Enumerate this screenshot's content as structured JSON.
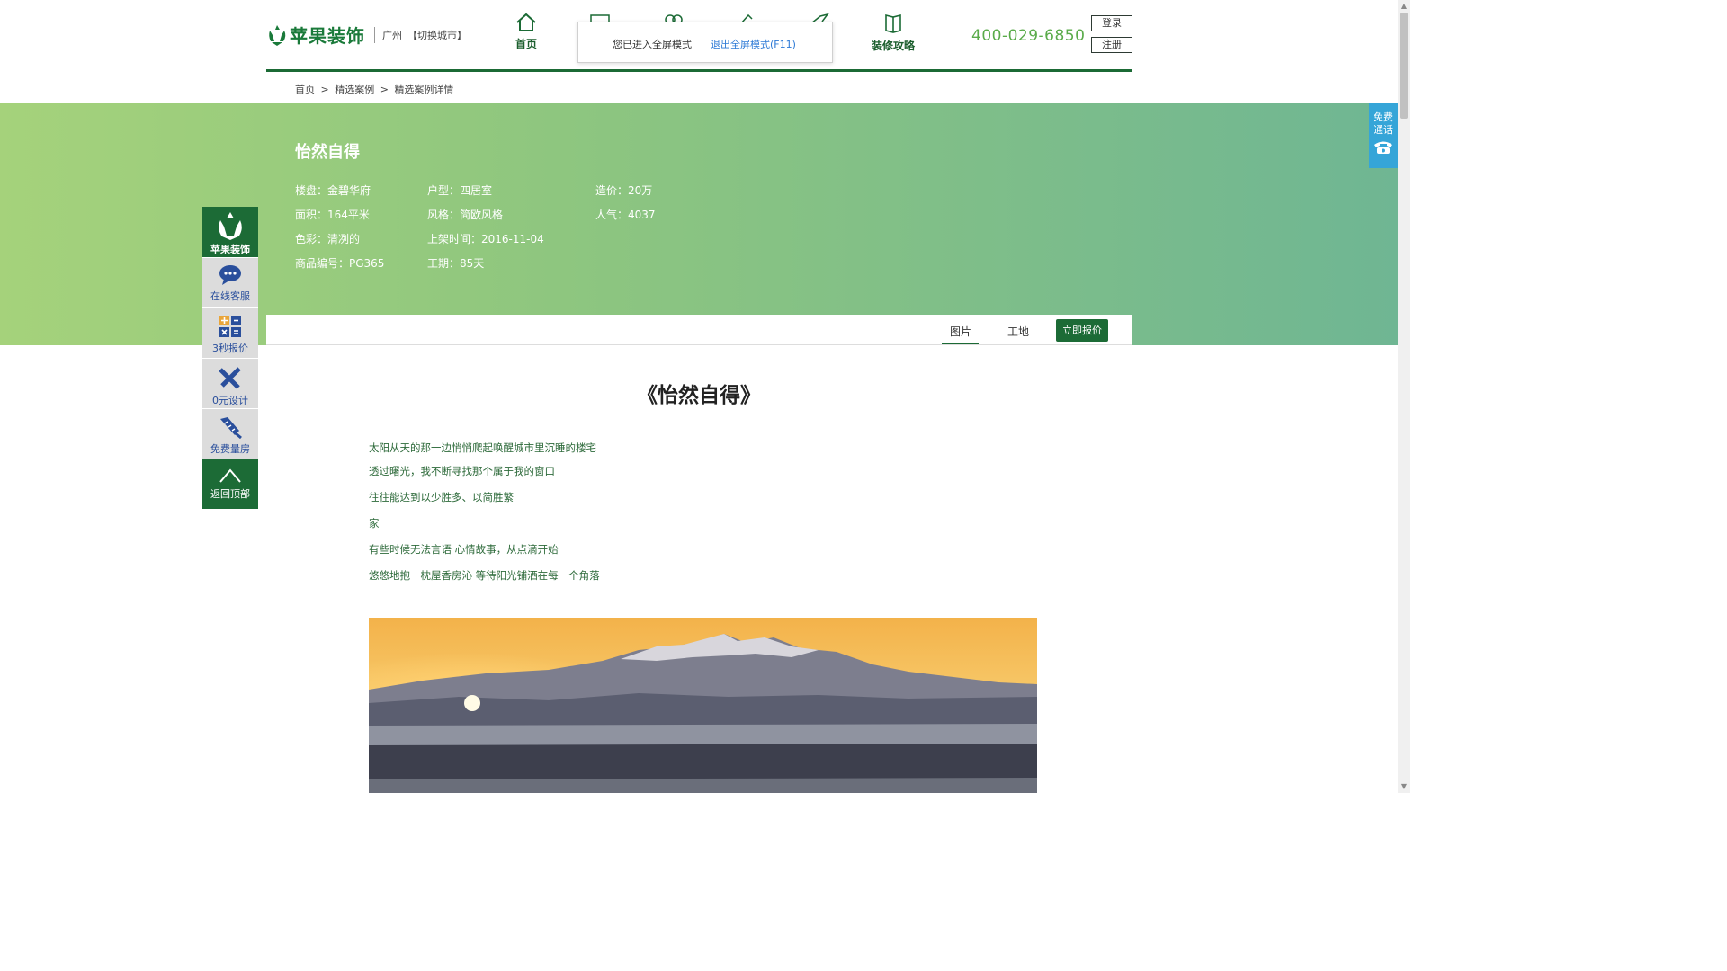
{
  "header": {
    "brand": "苹果装饰",
    "city": "广州",
    "switch_city": "【切换城市】",
    "nav": [
      {
        "label": "首页",
        "icon": "home-icon"
      },
      {
        "label": "装修攻略",
        "icon": "book-icon"
      }
    ],
    "phone": "400-029-6850",
    "login": "登录",
    "register": "注册"
  },
  "fullscreen_notice": {
    "text": "您已进入全屏模式",
    "exit": "退出全屏模式(F11)"
  },
  "breadcrumb": [
    "首页",
    ">",
    "精选案例",
    ">",
    "精选案例详情"
  ],
  "case": {
    "title": "怡然自得",
    "info": {
      "building": "楼盘：金碧华府",
      "layout": "户型：四居室",
      "cost": "造价：20万",
      "area": "面积：164平米",
      "style": "风格：简欧风格",
      "popularity": "人气：4037",
      "color": "色彩：清冽的",
      "listed": "上架时间：2016-11-04",
      "code": "商品编号：PG365",
      "duration": "工期：85天"
    },
    "tabs": [
      "图片",
      "工地"
    ],
    "quote_button": "立即报价"
  },
  "article": {
    "title": "《怡然自得》",
    "lines": [
      "太阳从天的那一边悄悄爬起唤醒城市里沉睡的楼宅",
      "透过曙光，我不断寻找那个属于我的窗口",
      "往往能达到以少胜多、以简胜繁",
      "家",
      "有些时候无法言语 心情故事，从点滴开始",
      "悠悠地抱一枕屋香房沁 等待阳光铺洒在每一个角落"
    ]
  },
  "sidebar": {
    "brand": "苹果装饰",
    "items": [
      {
        "label": "在线客服",
        "icon": "chat-bubble-icon"
      },
      {
        "label": "3秒报价",
        "icon": "calculator-icon"
      },
      {
        "label": "0元设计",
        "icon": "design-tools-icon"
      },
      {
        "label": "免费量房",
        "icon": "measure-tool-icon"
      }
    ],
    "back_top": "返回顶部"
  },
  "free_call": "免费通话",
  "colors": {
    "brand_green": "#1c6b36",
    "phone_green": "#5aab4a",
    "hero_start": "#a5d27b",
    "hero_end": "#6fb693",
    "call_blue": "#35a5d8"
  }
}
